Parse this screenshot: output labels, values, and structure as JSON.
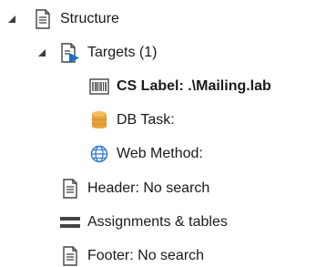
{
  "tree": {
    "structure": {
      "label": "Structure",
      "icon": "document-icon",
      "expanded": true
    },
    "targets": {
      "label": "Targets (1)",
      "icon": "document-play-icon",
      "expanded": true
    },
    "cs_label": {
      "label": "CS Label: .\\Mailing.lab",
      "icon": "barcode-icon"
    },
    "db_task": {
      "label": "DB Task:",
      "icon": "database-icon"
    },
    "web_method": {
      "label": "Web Method:",
      "icon": "globe-icon"
    },
    "header": {
      "label": "Header: No search",
      "icon": "document-icon"
    },
    "assignments": {
      "label": "Assignments & tables",
      "icon": "lines-icon"
    },
    "footer": {
      "label": "Footer: No search",
      "icon": "document-icon"
    }
  },
  "colors": {
    "expander": "#3c3c3c",
    "play": "#1f6fc5",
    "database": "#e8a33b",
    "globe": "#2a7bd1",
    "document": "#444444"
  }
}
